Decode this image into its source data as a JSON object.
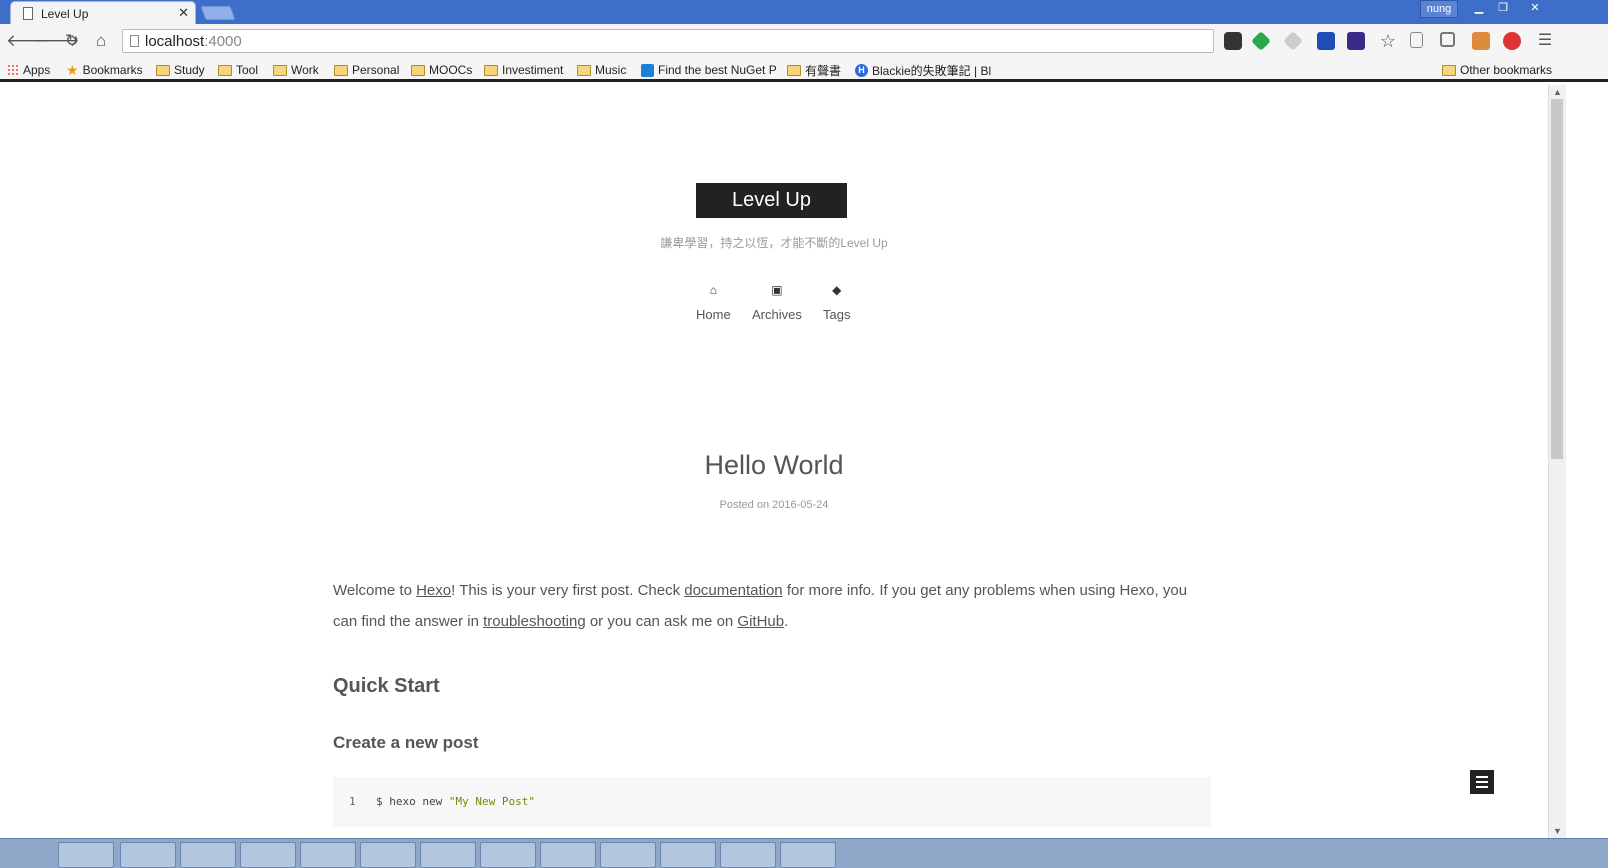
{
  "browser": {
    "tab_title": "Level Up",
    "profile_name": "nung",
    "url_host": "localhost",
    "url_port": ":4000"
  },
  "bookmarks": {
    "items": [
      {
        "label": "Apps",
        "icon": "apps-grid-icon"
      },
      {
        "label": "Bookmarks",
        "icon": "star-icon"
      },
      {
        "label": "Study",
        "icon": "folder-icon"
      },
      {
        "label": "Tool",
        "icon": "folder-icon"
      },
      {
        "label": "Work",
        "icon": "folder-icon"
      },
      {
        "label": "Personal",
        "icon": "folder-icon"
      },
      {
        "label": "MOOCs",
        "icon": "folder-icon"
      },
      {
        "label": "Investiment",
        "icon": "folder-icon"
      },
      {
        "label": "Music",
        "icon": "folder-icon"
      },
      {
        "label": "Find the best NuGet P",
        "icon": "nuget-icon"
      },
      {
        "label": "有聲書",
        "icon": "folder-icon"
      },
      {
        "label": "Blackie的失敗筆記 | Bl",
        "icon": "blog-icon"
      }
    ],
    "other_label": "Other bookmarks"
  },
  "site": {
    "brand": "Level Up",
    "subtitle": "謙卑學習，持之以恆，才能不斷的Level Up",
    "nav": [
      {
        "label": "Home",
        "icon": "home-icon"
      },
      {
        "label": "Archives",
        "icon": "archive-icon"
      },
      {
        "label": "Tags",
        "icon": "tags-icon"
      }
    ]
  },
  "post": {
    "title": "Hello World",
    "meta_prefix": "Posted on",
    "date": "2016-05-24",
    "p1_a": "Welcome to ",
    "link_hexo": "Hexo",
    "p1_b": "! This is your very first post. Check ",
    "link_docs": "documentation",
    "p1_c": " for more info. If you get any problems when using Hexo, you can find the answer in ",
    "link_trouble": "troubleshooting",
    "p1_d": " or you can ask me on ",
    "link_github": "GitHub",
    "p1_e": ".",
    "h2": "Quick Start",
    "h3": "Create a new post",
    "code_line_no": "1",
    "code_cmd": "$ hexo new ",
    "code_str": "\"My New Post\""
  }
}
